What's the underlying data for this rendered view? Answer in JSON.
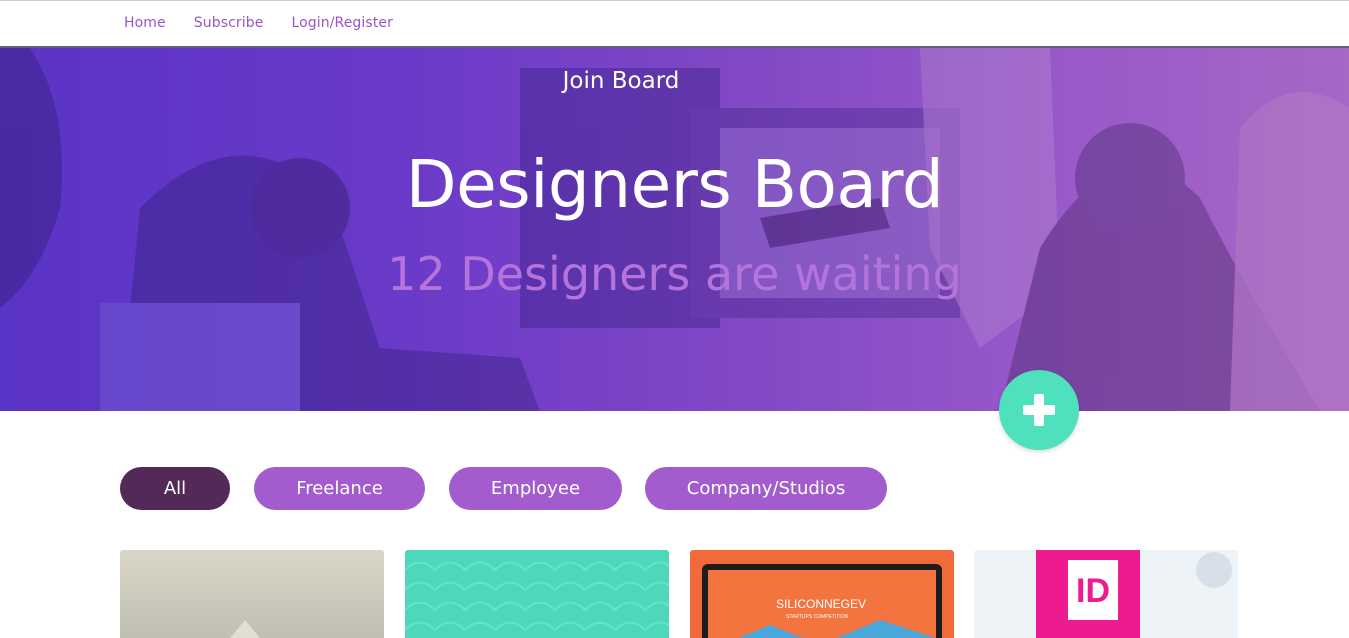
{
  "nav": {
    "items": [
      "Home",
      "Subscribe",
      "Login/Register"
    ]
  },
  "hero": {
    "join_label": "Join Board",
    "title": "Designers Board",
    "subtitle": "12 Designers are waiting"
  },
  "fab": {
    "icon": "plus-icon",
    "color": "#4fe0bd"
  },
  "filters": {
    "items": [
      {
        "label": "All",
        "active": true
      },
      {
        "label": "Freelance",
        "active": false
      },
      {
        "label": "Employee",
        "active": false
      },
      {
        "label": "Company/Studios",
        "active": false
      }
    ]
  },
  "cards": {
    "card3_text": "SILICONNEGEV",
    "card3_sub": "STARTUPS COMPETITION",
    "card4_text": "ID"
  },
  "colors": {
    "accent": "#a35ccd",
    "active_pill": "#522957",
    "fab": "#4fe0bd",
    "nav_link": "#9a55c4"
  }
}
